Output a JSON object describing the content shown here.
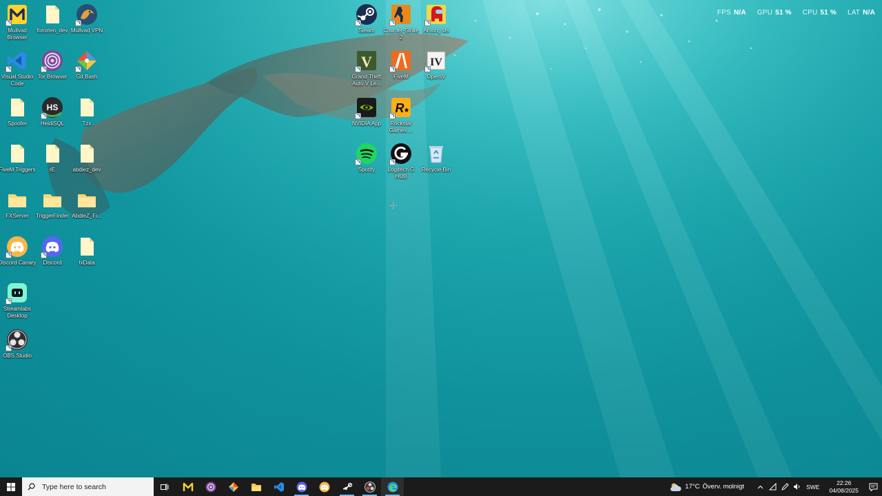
{
  "overlay": {
    "fps_label": "FPS",
    "fps_value": "N/A",
    "gpu_label": "GPU",
    "gpu_value": "51 %",
    "cpu_label": "CPU",
    "cpu_value": "51 %",
    "lat_label": "LAT",
    "lat_value": "N/A"
  },
  "desktop": {
    "icons": [
      {
        "label": "Mullvad Browser",
        "icon": "mullvad-browser-icon"
      },
      {
        "label": "fororten_dev",
        "icon": "text-file-icon"
      },
      {
        "label": "Mullvad VPN",
        "icon": "mullvad-vpn-icon"
      },
      {
        "label": "Visual Studio Code",
        "icon": "vscode-icon"
      },
      {
        "label": "Tor Browser",
        "icon": "tor-browser-icon"
      },
      {
        "label": "Git Bash",
        "icon": "git-bash-icon"
      },
      {
        "label": "Spoofer",
        "icon": "text-file-icon"
      },
      {
        "label": "HeidiSQL",
        "icon": "heidisql-icon"
      },
      {
        "label": "Tzx",
        "icon": "text-file-icon"
      },
      {
        "label": "FiveM Triggers",
        "icon": "text-file-icon"
      },
      {
        "label": "rE",
        "icon": "text-file-icon"
      },
      {
        "label": "abdiez_dev",
        "icon": "text-file-icon"
      },
      {
        "label": "FXServer",
        "icon": "folder-icon"
      },
      {
        "label": "TriggerFinder",
        "icon": "folder-icon"
      },
      {
        "label": "AbdieZ_Fi...",
        "icon": "folder-icon"
      },
      {
        "label": "Discord Canary",
        "icon": "discord-canary-icon"
      },
      {
        "label": "Discord",
        "icon": "discord-icon"
      },
      {
        "label": "txData",
        "icon": "text-file-icon"
      },
      {
        "label": "Streamlabs Desktop",
        "icon": "streamlabs-icon"
      },
      {
        "label": "OBS Studio",
        "icon": "obs-icon"
      },
      {
        "label": "Steam",
        "icon": "steam-icon"
      },
      {
        "label": "Counter-Strike 2",
        "icon": "counter-strike-icon"
      },
      {
        "label": "Among Us",
        "icon": "among-us-icon"
      },
      {
        "label": "Grand Theft Auto V Le...",
        "icon": "gta-v-icon"
      },
      {
        "label": "FiveM",
        "icon": "fivem-icon"
      },
      {
        "label": "OpenIV",
        "icon": "openiv-icon"
      },
      {
        "label": "NVIDIA App",
        "icon": "nvidia-icon"
      },
      {
        "label": "Rockstar Games ...",
        "icon": "rockstar-icon"
      },
      {
        "label": "Spotify",
        "icon": "spotify-icon"
      },
      {
        "label": "Logitech G HUB",
        "icon": "logitech-icon"
      },
      {
        "label": "Recycle Bin",
        "icon": "recycle-bin-icon"
      }
    ]
  },
  "taskbar": {
    "search_placeholder": "Type here to search",
    "apps": [
      "task-view-icon",
      "mullvad-browser-icon",
      "tor-browser-icon",
      "git-bash-icon",
      "file-explorer-icon",
      "vscode-icon",
      "discord-canary-icon",
      "discord-icon",
      "steam-icon",
      "obs-icon",
      "edge-icon"
    ],
    "weather": {
      "temp": "17°C",
      "desc": "Överv. molnigt"
    },
    "language": "SWE",
    "time": "22:26",
    "date": "04/08/2025"
  },
  "colors": {
    "accent": "#76b9ed",
    "water_top": "#37c7cb",
    "water_bottom": "#0a8895",
    "taskbar": "#1b1b1b"
  }
}
